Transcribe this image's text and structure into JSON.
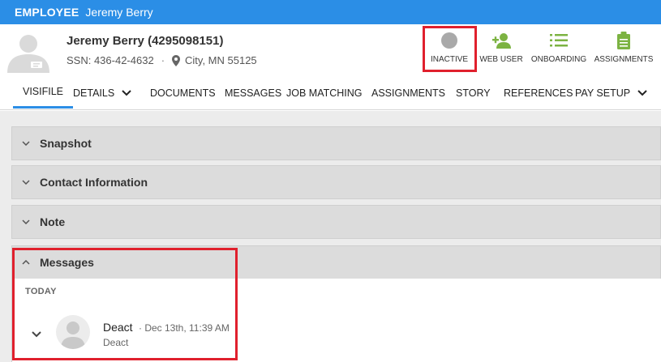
{
  "topbar": {
    "kind": "EMPLOYEE",
    "name": "Jeremy Berry"
  },
  "header": {
    "title": "Jeremy Berry (4295098151)",
    "ssn": "SSN: 436-42-4632",
    "separator": "·",
    "location": "City, MN 55125"
  },
  "actions": [
    {
      "label": "INACTIVE",
      "icon": "status-circle-icon"
    },
    {
      "label": "WEB USER",
      "icon": "add-user-icon"
    },
    {
      "label": "ONBOARDING",
      "icon": "checklist-icon"
    },
    {
      "label": "ASSIGNMENTS",
      "icon": "clipboard-icon"
    }
  ],
  "tabs": [
    {
      "label": "VISIFILE"
    },
    {
      "label": "DETAILS"
    },
    {
      "label": "DOCUMENTS"
    },
    {
      "label": "MESSAGES"
    },
    {
      "label": "JOB MATCHING"
    },
    {
      "label": "ASSIGNMENTS"
    },
    {
      "label": "STORY"
    },
    {
      "label": "REFERENCES"
    },
    {
      "label": "PAY SETUP"
    }
  ],
  "panels": [
    {
      "title": "Snapshot"
    },
    {
      "title": "Contact Information"
    },
    {
      "title": "Note"
    },
    {
      "title": "Messages"
    }
  ],
  "messages": {
    "group": "TODAY",
    "items": [
      {
        "sender": "Deact",
        "time": "· Dec 13th, 11:39 AM",
        "text": "Deact"
      }
    ]
  },
  "colors": {
    "brand": "#2b8ee6",
    "green": "#7cb342",
    "highlight": "#e0202d",
    "inactive": "#a9a9a9"
  }
}
